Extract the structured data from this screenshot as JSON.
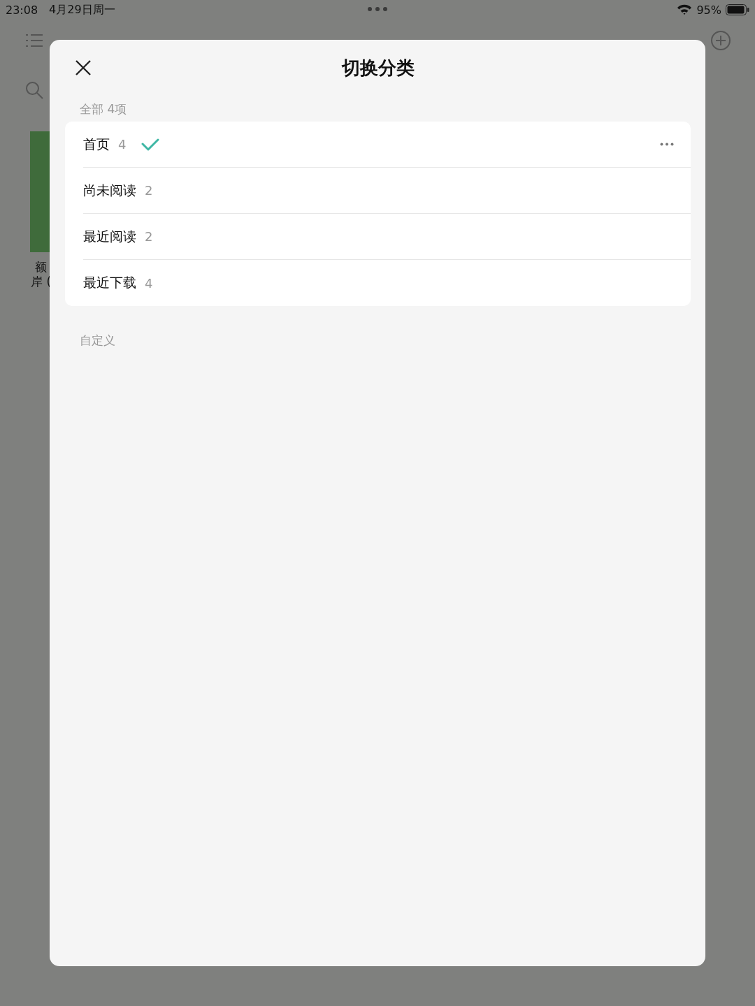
{
  "status_bar": {
    "time": "23:08",
    "date": "4月29日周一",
    "battery": "95%"
  },
  "background": {
    "book_title_lines": [
      "额",
      "岸 ("
    ]
  },
  "dialog": {
    "title": "切换分类",
    "section_all": "全部 4项",
    "categories": [
      {
        "name": "首页",
        "count": "4",
        "selected": true
      },
      {
        "name": "尚未阅读",
        "count": "2",
        "selected": false
      },
      {
        "name": "最近阅读",
        "count": "2",
        "selected": false
      },
      {
        "name": "最近下载",
        "count": "4",
        "selected": false
      }
    ],
    "section_custom": "自定义"
  }
}
